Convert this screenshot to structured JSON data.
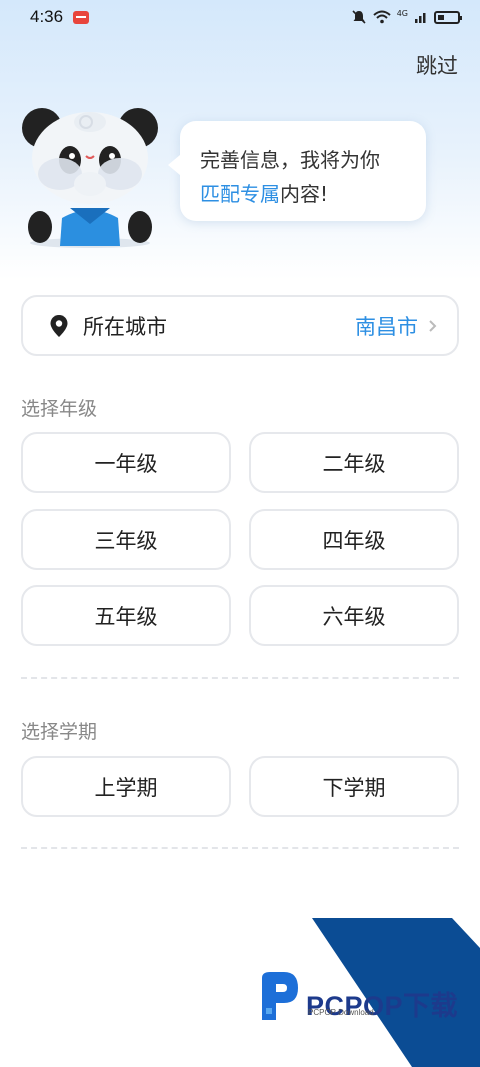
{
  "status_bar": {
    "time": "4:36",
    "network": "4G"
  },
  "header": {
    "skip_label": "跳过"
  },
  "bubble": {
    "line1": "完善信息，我将为你",
    "line2_highlight": "匹配专属",
    "line2_rest": "内容!"
  },
  "city": {
    "label": "所在城市",
    "value": "南昌市"
  },
  "grade_section": {
    "title": "选择年级",
    "options": [
      "一年级",
      "二年级",
      "三年级",
      "四年级",
      "五年级",
      "六年级"
    ]
  },
  "semester_section": {
    "title": "选择学期",
    "options": [
      "上学期",
      "下学期"
    ]
  },
  "watermark": {
    "brand": "PCPOP下载",
    "sub": "PCPOP Download"
  },
  "colors": {
    "accent": "#2d8fe3",
    "watermark_blue": "#0b4c94"
  }
}
